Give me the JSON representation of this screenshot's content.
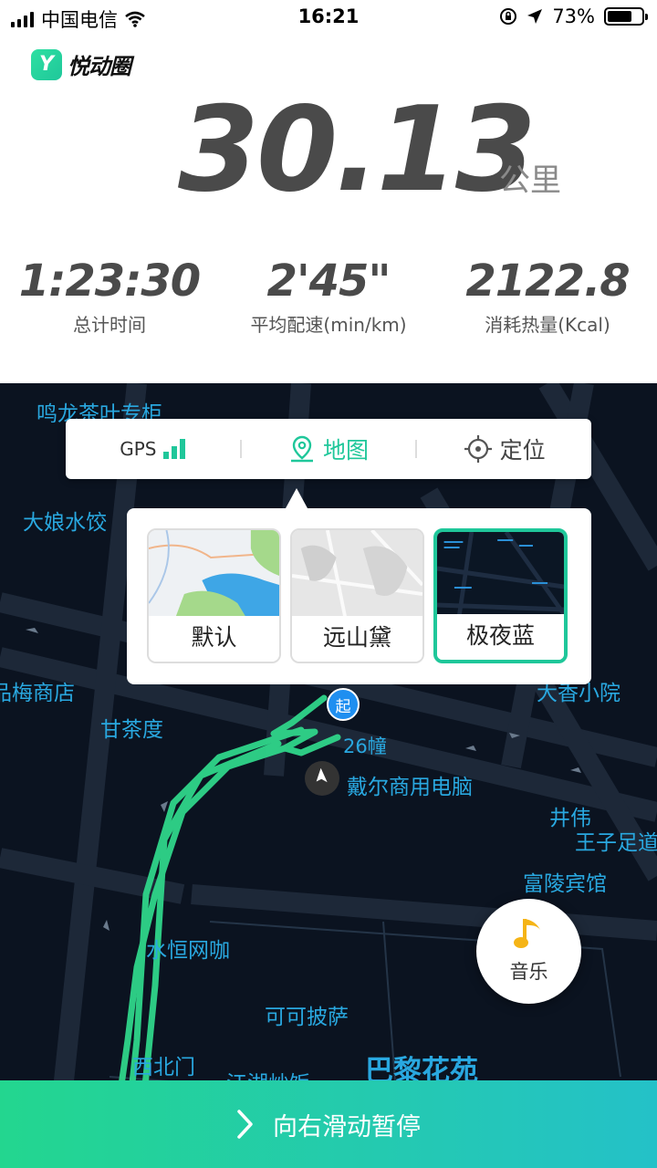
{
  "status_bar": {
    "carrier": "中国电信",
    "time": "16:21",
    "battery_percent": "73%",
    "battery_level": 0.73,
    "icons": [
      "signal-icon",
      "wifi-icon",
      "orientation-lock-icon",
      "location-arrow-icon",
      "battery-icon"
    ]
  },
  "app": {
    "logo_text": "悦动圈",
    "brand_color": "#1fc79a"
  },
  "distance": {
    "value": "30.13",
    "unit": "公里"
  },
  "stats": [
    {
      "value": "1:23:30",
      "label": "总计时间"
    },
    {
      "value": "2'45\"",
      "label": "平均配速(min/km)"
    },
    {
      "value": "2122.8",
      "label": "消耗热量(Kcal)"
    }
  ],
  "map_controls": {
    "gps_label": "GPS",
    "map_label": "地图",
    "locate_label": "定位"
  },
  "map_styles": [
    {
      "name": "默认",
      "selected": false
    },
    {
      "name": "远山黛",
      "selected": false
    },
    {
      "name": "极夜蓝",
      "selected": true
    }
  ],
  "map": {
    "pois": [
      "鸣龙茶叶专柜",
      "大娘水饺",
      "品梅商店",
      "甘茶度",
      "大香小院",
      "26幢",
      "戴尔商用电脑",
      "井伟",
      "王子足道",
      "富陵宾馆",
      "水恒网咖",
      "可可披萨",
      "西北门",
      "江湖炒饭",
      "巴黎花苑"
    ],
    "start_marker": "起",
    "poi_color": "#29a8e0",
    "route_color": "#2fd58a"
  },
  "music": {
    "label": "音乐"
  },
  "bottom": {
    "slide_label": "向右滑动暂停"
  }
}
